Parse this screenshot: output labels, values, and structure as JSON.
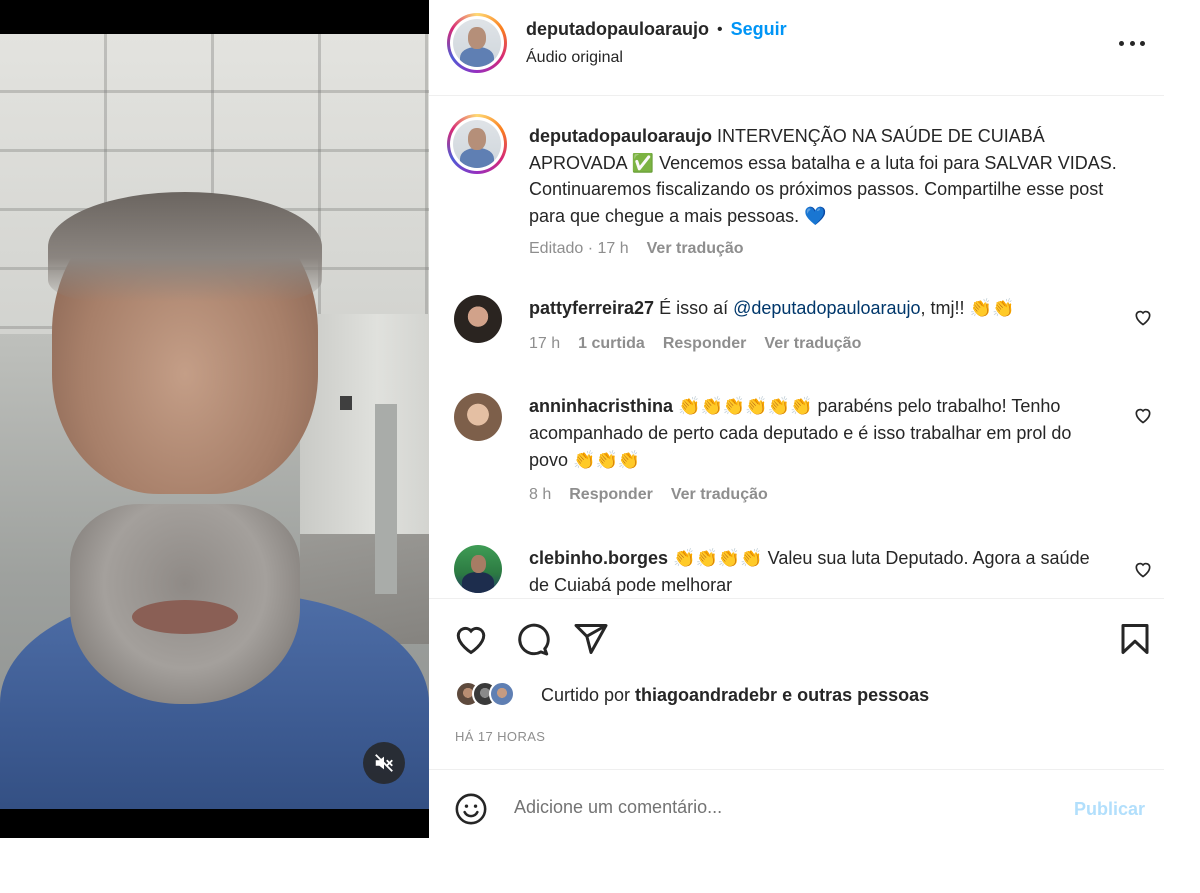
{
  "post": {
    "author": "deputadopauloaraujo",
    "separator": "•",
    "follow_label": "Seguir",
    "audio_label": "Áudio original",
    "caption_text": "INTERVENÇÃO NA SAÚDE DE CUIABÁ APROVADA ✅ Vencemos essa batalha e a luta foi para SALVAR VIDAS. Continuaremos fiscalizando os próximos passos. Compartilhe esse post para que chegue a mais pessoas. 💙",
    "caption_meta_edited": "Editado · 17 h",
    "caption_meta_translate": "Ver tradução"
  },
  "comments": [
    {
      "username": "pattyferreira27",
      "text_before": " É isso aí ",
      "mention": "@deputadopauloaraujo",
      "text_after": ", tmj!! 👏👏",
      "time": "17 h",
      "likes": "1 curtida",
      "reply": "Responder",
      "translate": "Ver tradução"
    },
    {
      "username": "anninhacristhina",
      "text": " 👏👏👏👏👏👏 parabéns pelo trabalho! Tenho acompanhado de perto cada deputado e é isso trabalhar em prol do povo 👏👏👏",
      "time": "8 h",
      "reply": "Responder",
      "translate": "Ver tradução"
    },
    {
      "username": "clebinho.borges",
      "text": " 👏👏👏👏 Valeu sua luta Deputado. Agora a saúde de Cuiabá pode melhorar"
    }
  ],
  "likes": {
    "prefix": "Curtido por ",
    "user": "thiagoandradebr",
    "suffix": " e outras pessoas"
  },
  "post_time": "HÁ 17 HORAS",
  "comment_box": {
    "placeholder": "Adicione um comentário...",
    "publish_label": "Publicar"
  },
  "icons": {
    "mute": "speaker-muted-icon",
    "more": "more-options-icon",
    "like": "heart-icon",
    "comment": "comment-bubble-icon",
    "share": "paper-plane-icon",
    "save": "bookmark-icon",
    "emoji": "smiley-icon"
  },
  "colors": {
    "link_blue": "#0095f6",
    "mention_blue": "#00376b",
    "muted_text": "#8e8e8e",
    "publish_disabled": "#b2dffc"
  }
}
